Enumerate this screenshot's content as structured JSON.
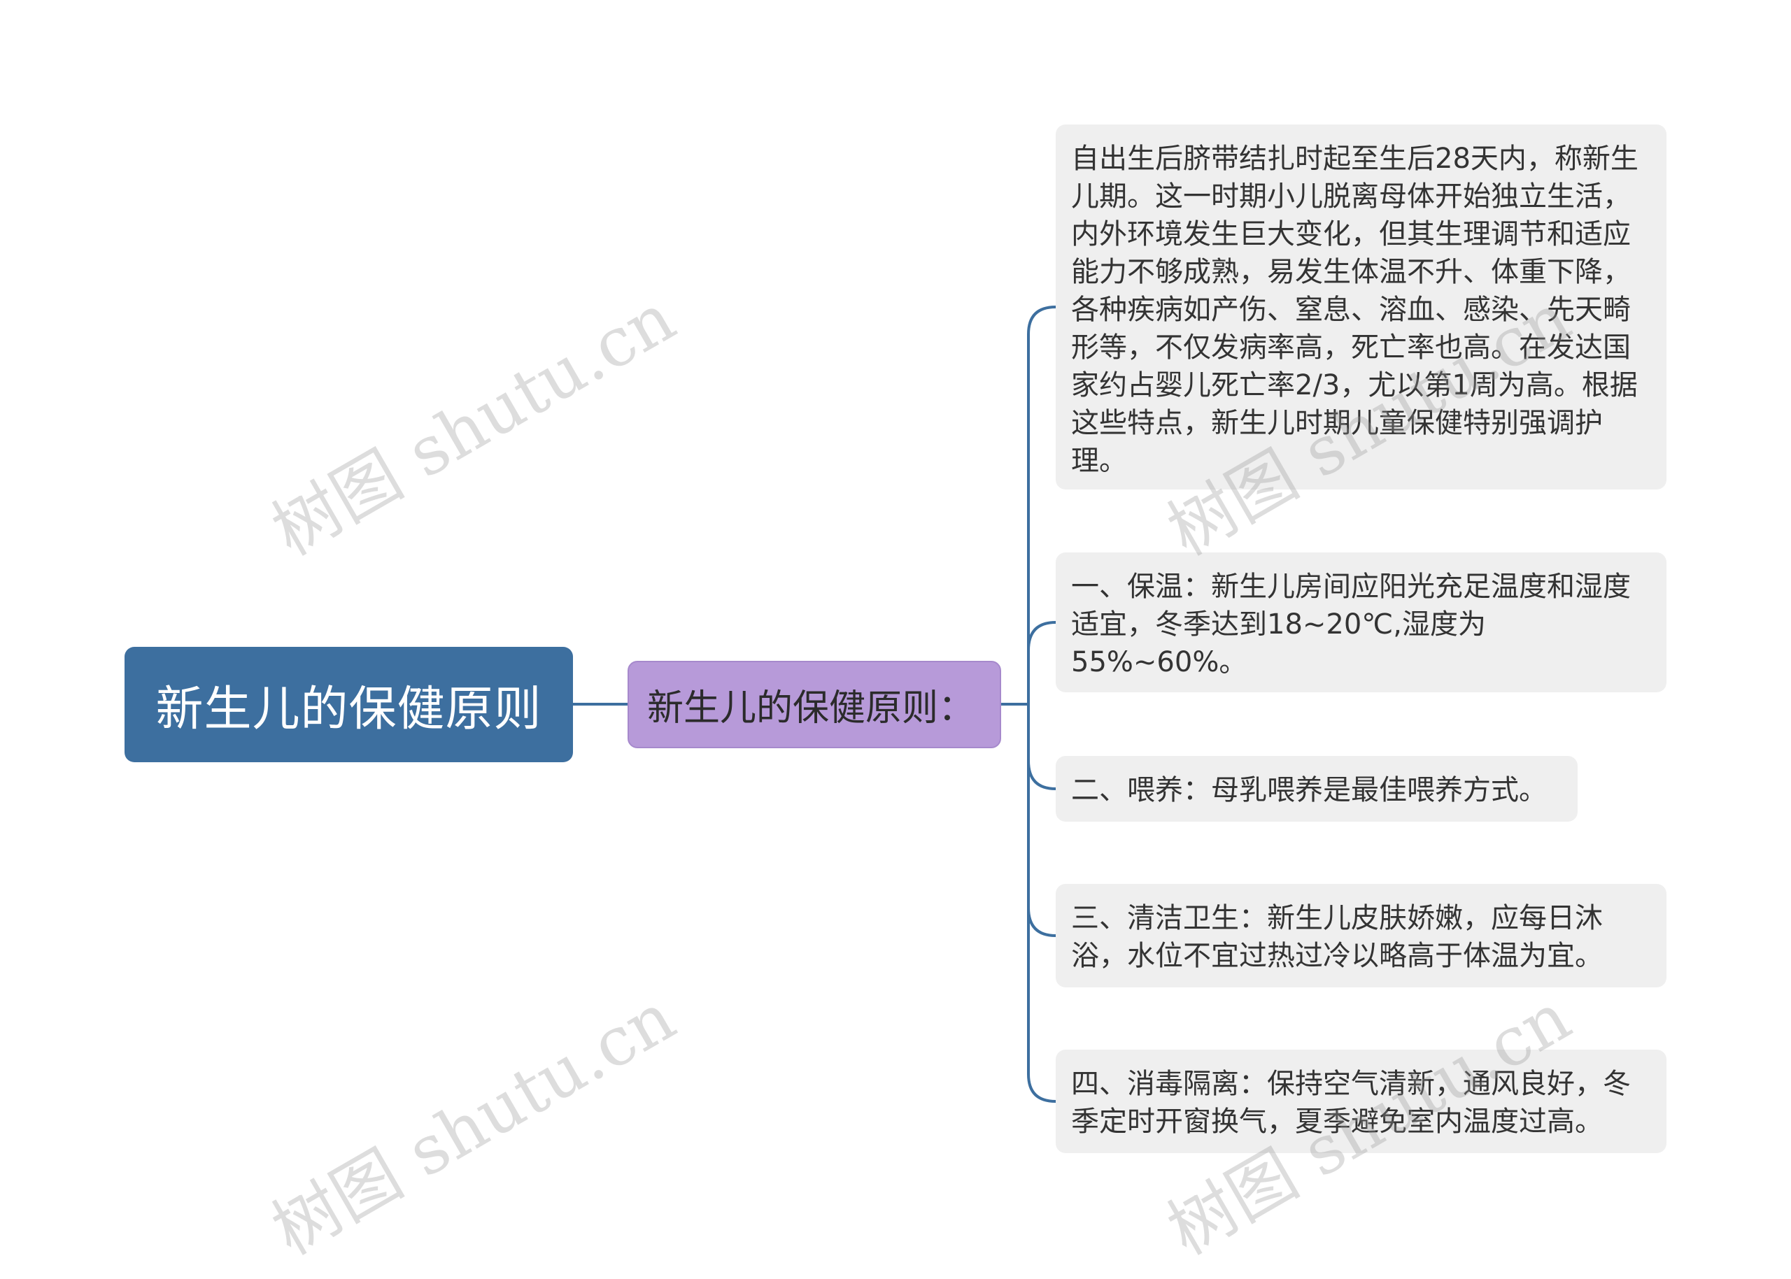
{
  "root": {
    "label": "新生儿的保健原则"
  },
  "branch": {
    "label": "新生儿的保健原则："
  },
  "leaves": [
    {
      "text": "自出生后脐带结扎时起至生后28天内，称新生儿期。这一时期小儿脱离母体开始独立生活，内外环境发生巨大变化，但其生理调节和适应能力不够成熟，易发生体温不升、体重下降，各种疾病如产伤、窒息、溶血、感染、先天畸形等，不仅发病率高，死亡率也高。在发达国家约占婴儿死亡率2/3，尤以第1周为高。根据这些特点，新生儿时期儿童保健特别强调护理。"
    },
    {
      "text": "一、保温：新生儿房间应阳光充足温度和湿度适宜，冬季达到18~20℃,湿度为55%~60%。"
    },
    {
      "text": "二、喂养：母乳喂养是最佳喂养方式。"
    },
    {
      "text": "三、清洁卫生：新生儿皮肤娇嫩，应每日沐浴，水位不宜过热过冷以略高于体温为宜。"
    },
    {
      "text": "四、消毒隔离：保持空气清新，通风良好，冬季定时开窗换气，夏季避免室内温度过高。"
    }
  ],
  "watermark": {
    "text": "树图 shutu.cn"
  },
  "colors": {
    "root_fill": "#3d6f9f",
    "branch_fill": "#b79ad9",
    "leaf_fill": "#efefef",
    "connector": "#3d6f9f"
  }
}
